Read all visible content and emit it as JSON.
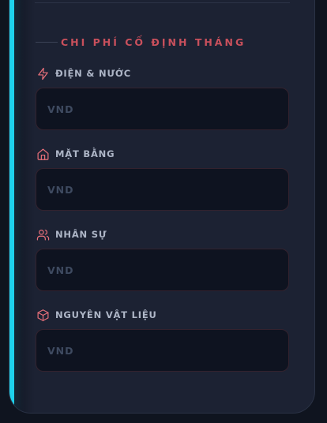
{
  "section": {
    "title": "CHI PHÍ CỐ ĐỊNH THÁNG"
  },
  "fields": [
    {
      "label": "ĐIỆN & NƯỚC",
      "icon": "lightning-icon",
      "value": "",
      "placeholder": "VND"
    },
    {
      "label": "MẶT BẰNG",
      "icon": "home-icon",
      "value": "",
      "placeholder": "VND"
    },
    {
      "label": "NHÂN SỰ",
      "icon": "users-icon",
      "value": "",
      "placeholder": "VND"
    },
    {
      "label": "NGUYÊN VẬT LIỆU",
      "icon": "box-icon",
      "value": "",
      "placeholder": "VND"
    }
  ],
  "colors": {
    "accent": "#1ed2ec",
    "title": "#c9505c",
    "icon": "#e8707a",
    "card": "#1c2233",
    "background": "#0f141f",
    "input": "#0e1320"
  }
}
